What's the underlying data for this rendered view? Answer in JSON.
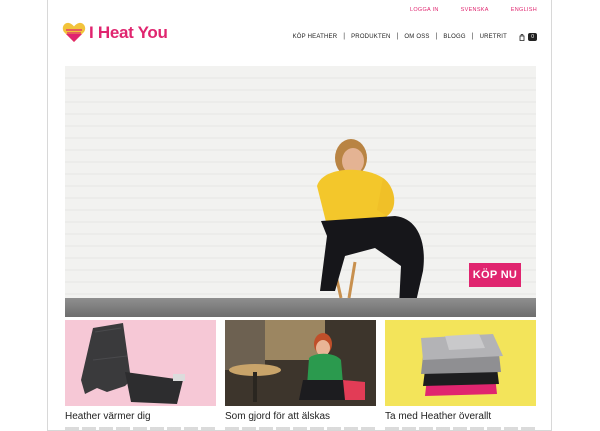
{
  "topbar": {
    "links": [
      "LOGGA IN",
      "SVENSKA",
      "ENGLISH"
    ]
  },
  "brand": {
    "name": "I Heat You",
    "color": "#e0256f"
  },
  "nav": {
    "items": [
      "KÖP HEATHER",
      "PRODUKTEN",
      "OM OSS",
      "BLOGG",
      "UREТRIT"
    ],
    "separator": "|"
  },
  "cart": {
    "icon": "shopping-bag-icon",
    "count": "0"
  },
  "hero": {
    "cta_label": "KÖP NU"
  },
  "cards": [
    {
      "title": "Heather värmer dig"
    },
    {
      "title": "Som gjord för att älskas"
    },
    {
      "title": "Ta med Heather överallt"
    }
  ]
}
